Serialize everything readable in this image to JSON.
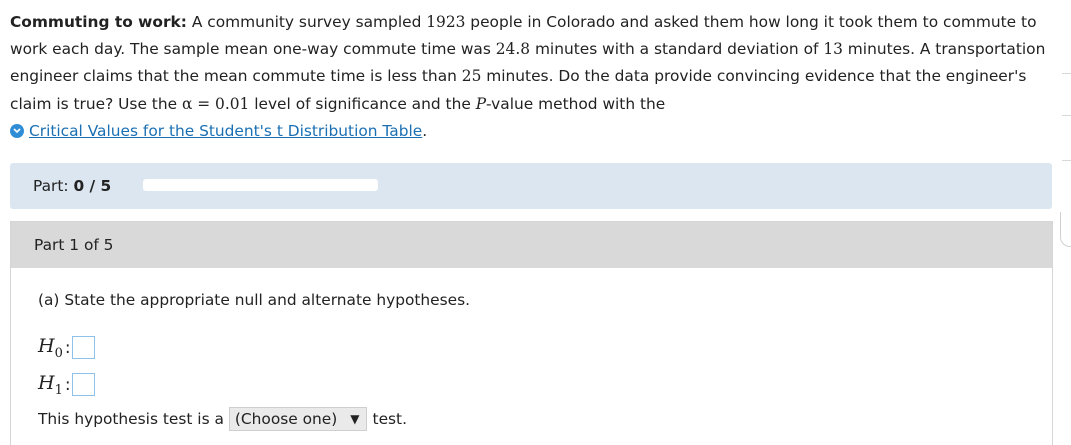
{
  "problem": {
    "lead": "Commuting to work:",
    "t1": " A community survey sampled ",
    "n": "1923",
    "t2": " people in Colorado and asked them how long it took them to commute to work each day. The sample mean one-way commute time was ",
    "mean": "24.8",
    "t3": " minutes with a standard deviation of ",
    "sd": "13",
    "t4": " minutes. A transportation engineer claims that the mean commute time is less than ",
    "mu0": "25",
    "t5": " minutes. Do the data provide convincing evidence that the engineer's claim is true? Use the ",
    "alpha_expr": "α = 0.01",
    "t6": " level of significance and the ",
    "pvar": "P",
    "t7": "-value method with the",
    "link": "Critical Values for the Student's t Distribution Table",
    "link_end": "."
  },
  "part_bar": {
    "label": "Part:",
    "value": "0 / 5",
    "progress": 0
  },
  "part": {
    "header": "Part 1 of 5",
    "question": "(a) State the appropriate null and alternate hypotheses.",
    "h0": "H",
    "h0_sub": "0",
    "h1": "H",
    "h1_sub": "1",
    "colon": ":",
    "test_prefix": "This hypothesis test is a",
    "test_select": "(Choose one)",
    "test_suffix": "test."
  },
  "icons": {
    "link": "expand-chevron-icon",
    "select_caret": "caret-down-icon"
  },
  "colors": {
    "link": "#1a6fb3",
    "part_bar_bg": "#dbe6f0",
    "part_header_bg": "#d9d9d9",
    "answer_box_border": "#8fc2ea"
  }
}
